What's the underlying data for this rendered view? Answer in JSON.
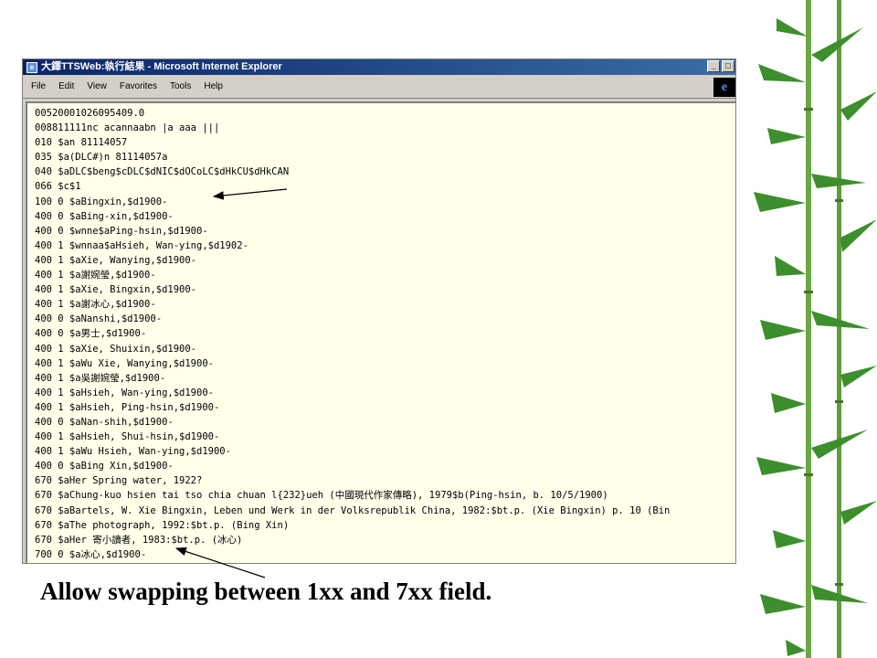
{
  "window": {
    "title": "大鐸TTSWeb:執行結果 - Microsoft Internet Explorer",
    "minimize_label": "_",
    "maximize_label": "□"
  },
  "menu": [
    "File",
    "Edit",
    "View",
    "Favorites",
    "Tools",
    "Help"
  ],
  "record_lines": [
    "00520001026095409.0",
    "008811111nc acannaabn |a aaa |||",
    "010 $an 81114057",
    "035 $a(DLC#)n 81114057a",
    "040 $aDLC$beng$cDLC$dNIC$dOCoLC$dHkCU$dHkCAN",
    "066 $c$1",
    "100 0 $aBingxin,$d1900-",
    "400 0 $aBing-xin,$d1900-",
    "400 0 $wnne$aPing-hsin,$d1900-",
    "400 1 $wnnaa$aHsieh, Wan-ying,$d1902-",
    "400 1 $aXie, Wanying,$d1900-",
    "400 1 $a謝婉瑩,$d1900-",
    "400 1 $aXie, Bingxin,$d1900-",
    "400 1 $a謝冰心,$d1900-",
    "400 0 $aNanshi,$d1900-",
    "400 0 $a男士,$d1900-",
    "400 1 $aXie, Shuixin,$d1900-",
    "400 1 $aWu Xie, Wanying,$d1900-",
    "400 1 $a吳謝婉瑩,$d1900-",
    "400 1 $aHsieh, Wan-ying,$d1900-",
    "400 1 $aHsieh, Ping-hsin,$d1900-",
    "400 0 $aNan-shih,$d1900-",
    "400 1 $aHsieh, Shui-hsin,$d1900-",
    "400 1 $aWu Hsieh, Wan-ying,$d1900-",
    "400 0 $aBing Xin,$d1900-",
    "670 $aHer Spring water, 1922?",
    "670 $aChung-kuo hsien tai tso chia chuan l{232}ueh (中國現代作家傳略), 1979$b(Ping-hsin, b. 10/5/1900)",
    "670 $aBartels, W. Xie Bingxin, Leben und Werk in der Volksrepublik China, 1982:$bt.p. (Xie Bingxin) p. 10 (Bin",
    "670 $aThe photograph, 1992:$bt.p. (Bing Xin)",
    "670 $aHer 寄小讀者, 1983:$bt.p. (冰心)",
    "700 0 $a冰心,$d1900-"
  ],
  "caption": "Allow swapping between 1xx and 7xx field.",
  "colors": {
    "title_bar_start": "#0a246a",
    "title_bar_end": "#3a6ea5",
    "window_chrome": "#d4d0c8",
    "content_bg": "#ffffea",
    "bamboo_green": "#3c8f2c"
  },
  "icons": [
    "ie-window-icon",
    "ie-logo-icon",
    "bamboo-decoration"
  ]
}
